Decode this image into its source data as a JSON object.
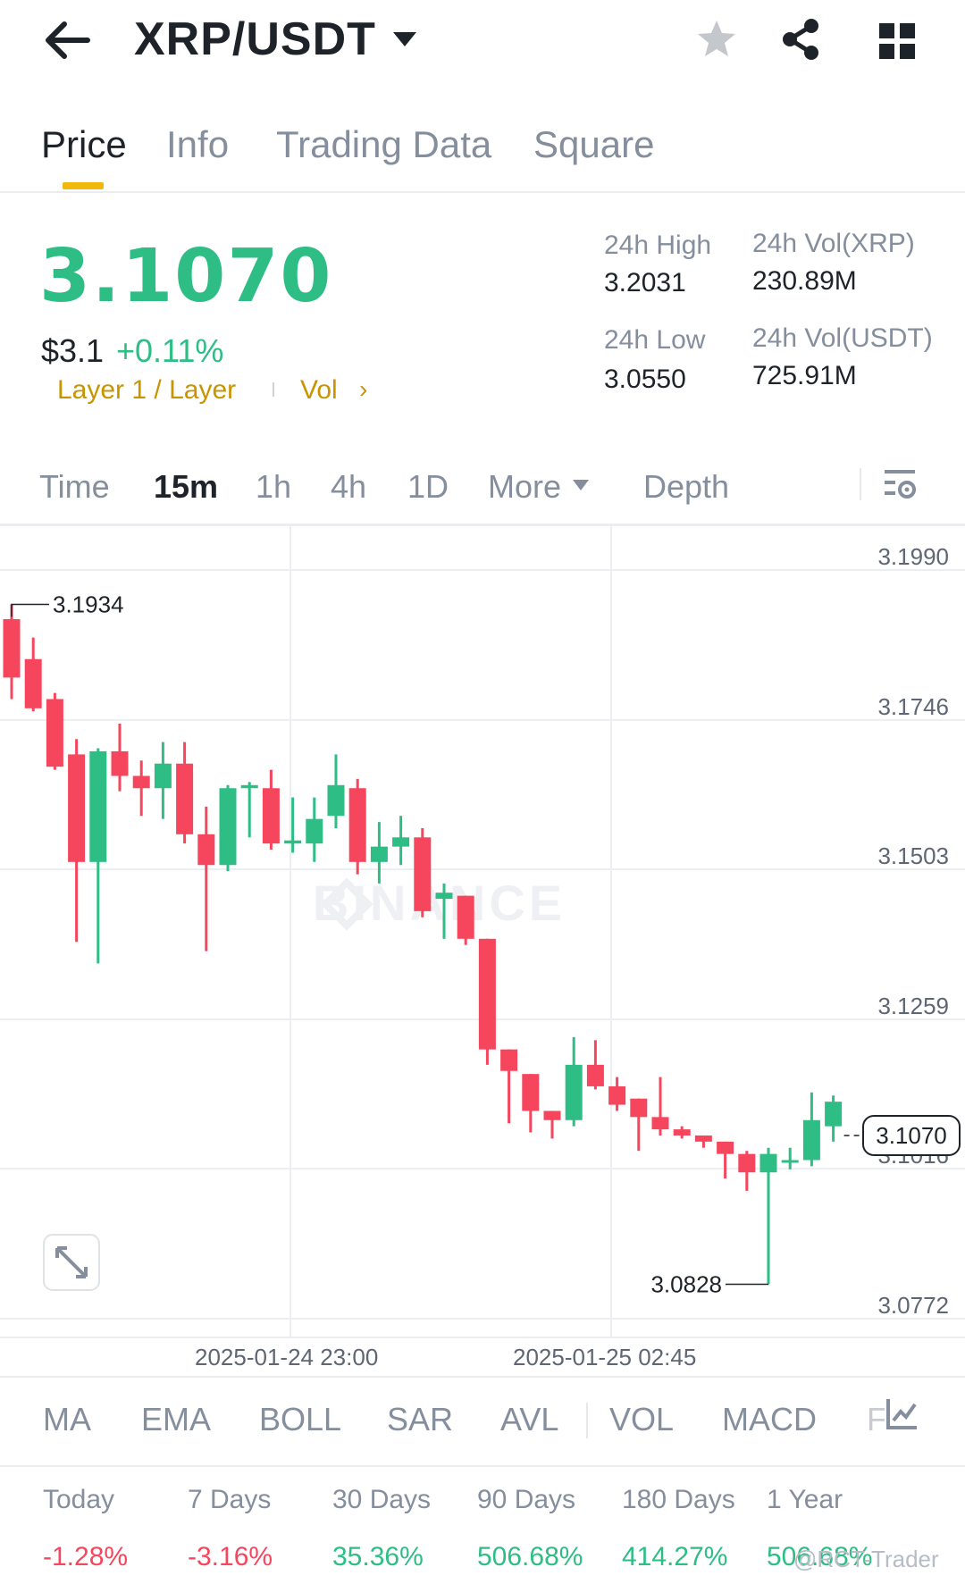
{
  "header": {
    "pair": "XRP/USDT",
    "back_icon": "arrow-left-icon",
    "dropdown_icon": "caret-down-icon",
    "favorite_icon": "star-icon",
    "share_icon": "share-icon",
    "menu_icon": "grid-icon"
  },
  "tabs": [
    {
      "label": "Price",
      "active": true
    },
    {
      "label": "Info",
      "active": false
    },
    {
      "label": "Trading Data",
      "active": false
    },
    {
      "label": "Square",
      "active": false
    }
  ],
  "ticker": {
    "last_price": "3.1070",
    "usd_price": "$3.1",
    "change": "+0.11%",
    "tag_layer": "Layer 1 / Layer",
    "tag_vol": "Vol",
    "tag_arrow": "›",
    "stats": {
      "high_label": "24h High",
      "high_value": "3.2031",
      "vol_xrp_label": "24h Vol(XRP)",
      "vol_xrp_value": "230.89M",
      "low_label": "24h Low",
      "low_value": "3.0550",
      "vol_usdt_label": "24h Vol(USDT)",
      "vol_usdt_value": "725.91M"
    }
  },
  "intervals": {
    "time": "Time",
    "m15": "15m",
    "h1": "1h",
    "h4": "4h",
    "d1": "1D",
    "more": "More",
    "depth": "Depth",
    "active": "15m"
  },
  "chart_data": {
    "type": "candlestick",
    "y_ticks": [
      "3.1990",
      "3.1746",
      "3.1503",
      "3.1259",
      "3.1016",
      "3.0772"
    ],
    "ylim": [
      3.0772,
      3.199
    ],
    "x_ticks": [
      "2025-01-24 23:00",
      "2025-01-25 02:45"
    ],
    "last_price_label": "3.1070",
    "high_annotation": "3.1934",
    "low_annotation": "3.0828",
    "watermark": "BINANCE",
    "colors": {
      "up": "#2ebd85",
      "down": "#f6465d"
    },
    "candles": [
      {
        "o": 3.191,
        "h": 3.1934,
        "l": 3.178,
        "c": 3.1815
      },
      {
        "o": 3.1845,
        "h": 3.188,
        "l": 3.176,
        "c": 3.1765
      },
      {
        "o": 3.178,
        "h": 3.179,
        "l": 3.1665,
        "c": 3.167
      },
      {
        "o": 3.169,
        "h": 3.1715,
        "l": 3.1385,
        "c": 3.1515
      },
      {
        "o": 3.1515,
        "h": 3.17,
        "l": 3.135,
        "c": 3.1695
      },
      {
        "o": 3.1695,
        "h": 3.174,
        "l": 3.163,
        "c": 3.1655
      },
      {
        "o": 3.1655,
        "h": 3.168,
        "l": 3.159,
        "c": 3.1635
      },
      {
        "o": 3.1635,
        "h": 3.171,
        "l": 3.1585,
        "c": 3.1675
      },
      {
        "o": 3.1675,
        "h": 3.171,
        "l": 3.1545,
        "c": 3.156
      },
      {
        "o": 3.156,
        "h": 3.1605,
        "l": 3.137,
        "c": 3.151
      },
      {
        "o": 3.151,
        "h": 3.164,
        "l": 3.15,
        "c": 3.1635
      },
      {
        "o": 3.1635,
        "h": 3.1645,
        "l": 3.1555,
        "c": 3.164
      },
      {
        "o": 3.1635,
        "h": 3.1665,
        "l": 3.1535,
        "c": 3.1545
      },
      {
        "o": 3.1545,
        "h": 3.162,
        "l": 3.153,
        "c": 3.155
      },
      {
        "o": 3.1545,
        "h": 3.162,
        "l": 3.1515,
        "c": 3.1585
      },
      {
        "o": 3.159,
        "h": 3.169,
        "l": 3.157,
        "c": 3.164
      },
      {
        "o": 3.1635,
        "h": 3.165,
        "l": 3.1495,
        "c": 3.1515
      },
      {
        "o": 3.1515,
        "h": 3.158,
        "l": 3.148,
        "c": 3.154
      },
      {
        "o": 3.154,
        "h": 3.159,
        "l": 3.151,
        "c": 3.1555
      },
      {
        "o": 3.1555,
        "h": 3.157,
        "l": 3.1425,
        "c": 3.1435
      },
      {
        "o": 3.1455,
        "h": 3.148,
        "l": 3.139,
        "c": 3.1465
      },
      {
        "o": 3.146,
        "h": 3.146,
        "l": 3.138,
        "c": 3.139
      },
      {
        "o": 3.139,
        "h": 3.139,
        "l": 3.1185,
        "c": 3.121
      },
      {
        "o": 3.121,
        "h": 3.121,
        "l": 3.109,
        "c": 3.1175
      },
      {
        "o": 3.117,
        "h": 3.117,
        "l": 3.1075,
        "c": 3.111
      },
      {
        "o": 3.111,
        "h": 3.111,
        "l": 3.1065,
        "c": 3.1095
      },
      {
        "o": 3.1095,
        "h": 3.123,
        "l": 3.1085,
        "c": 3.1185
      },
      {
        "o": 3.1185,
        "h": 3.1225,
        "l": 3.1145,
        "c": 3.115
      },
      {
        "o": 3.115,
        "h": 3.1165,
        "l": 3.111,
        "c": 3.112
      },
      {
        "o": 3.113,
        "h": 3.113,
        "l": 3.1045,
        "c": 3.11
      },
      {
        "o": 3.11,
        "h": 3.1165,
        "l": 3.107,
        "c": 3.108
      },
      {
        "o": 3.108,
        "h": 3.1085,
        "l": 3.1065,
        "c": 3.107
      },
      {
        "o": 3.107,
        "h": 3.107,
        "l": 3.105,
        "c": 3.106
      },
      {
        "o": 3.106,
        "h": 3.106,
        "l": 3.1,
        "c": 3.104
      },
      {
        "o": 3.104,
        "h": 3.1045,
        "l": 3.098,
        "c": 3.101
      },
      {
        "o": 3.101,
        "h": 3.105,
        "l": 3.0828,
        "c": 3.104
      },
      {
        "o": 3.103,
        "h": 3.105,
        "l": 3.1015,
        "c": 3.103
      },
      {
        "o": 3.103,
        "h": 3.114,
        "l": 3.102,
        "c": 3.1095
      },
      {
        "o": 3.1085,
        "h": 3.1135,
        "l": 3.106,
        "c": 3.1125
      }
    ]
  },
  "x_axis": {
    "t1": "2025-01-24 23:00",
    "t2": "2025-01-25 02:45"
  },
  "indicators": [
    {
      "label": "MA"
    },
    {
      "label": "EMA"
    },
    {
      "label": "BOLL"
    },
    {
      "label": "SAR"
    },
    {
      "label": "AVL"
    },
    {
      "label": "VOL"
    },
    {
      "label": "MACD"
    }
  ],
  "indicator_fade": "F",
  "performance": [
    {
      "label": "Today",
      "value": "-1.28%",
      "sign": "down"
    },
    {
      "label": "7 Days",
      "value": "-3.16%",
      "sign": "down"
    },
    {
      "label": "30 Days",
      "value": "35.36%",
      "sign": "up"
    },
    {
      "label": "90 Days",
      "value": "506.68%",
      "sign": "up"
    },
    {
      "label": "180 Days",
      "value": "414.27%",
      "sign": "up"
    },
    {
      "label": "1 Year",
      "value": "506.68%",
      "sign": "up"
    }
  ],
  "credit": "@RCT-Trader"
}
